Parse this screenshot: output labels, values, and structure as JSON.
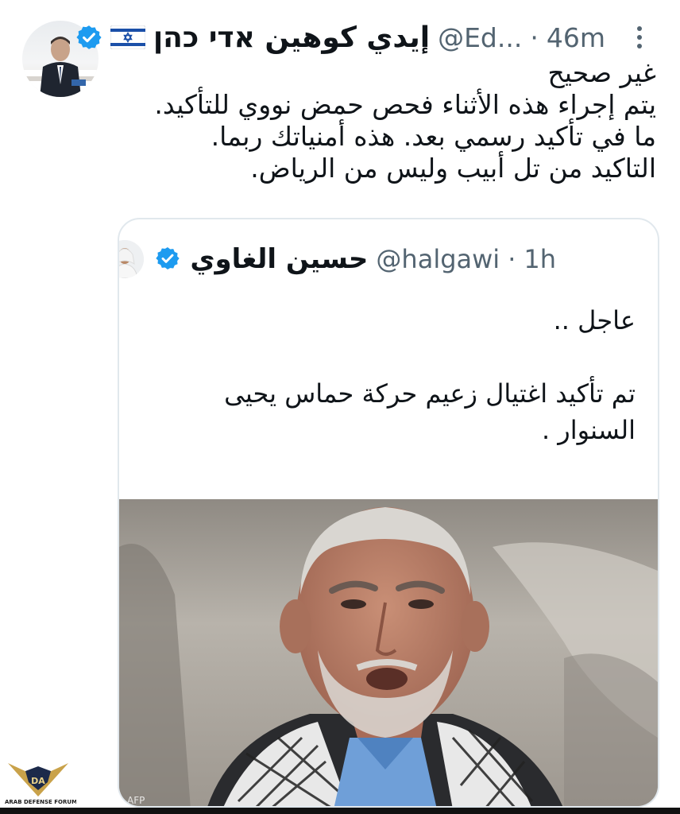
{
  "tweet": {
    "author_name": "إيدي كوهين אדי כהן",
    "handle": "@Ed...",
    "separator": "·",
    "time": "46m",
    "verified": true,
    "flag_icon": "israel-flag-icon",
    "text_lines": [
      "غير صحيح",
      "يتم إجراء هذه الأثناء فحص حمض نووي للتأكيد.",
      "ما في تأكيد رسمي بعد. هذه أمنياتك ربما.",
      "التاكيد من تل أبيب وليس من الرياض."
    ]
  },
  "quote": {
    "author_name": "حسين الغاوي",
    "handle": "@halgawi",
    "separator": "·",
    "time": "1h",
    "verified": true,
    "text_lines": [
      "عاجل ..",
      "",
      "تم تأكيد اغتيال زعيم حركة حماس يحيى",
      "السنوار ."
    ],
    "ellipsis": "...",
    "photo_credit": "AFP"
  },
  "watermark": {
    "logo_letters": "DA",
    "text": "ARAB DEFENSE FORUM"
  },
  "colors": {
    "verified_blue": "#1d9bf0",
    "secondary_text": "#536471",
    "border": "#e1e8ed"
  }
}
